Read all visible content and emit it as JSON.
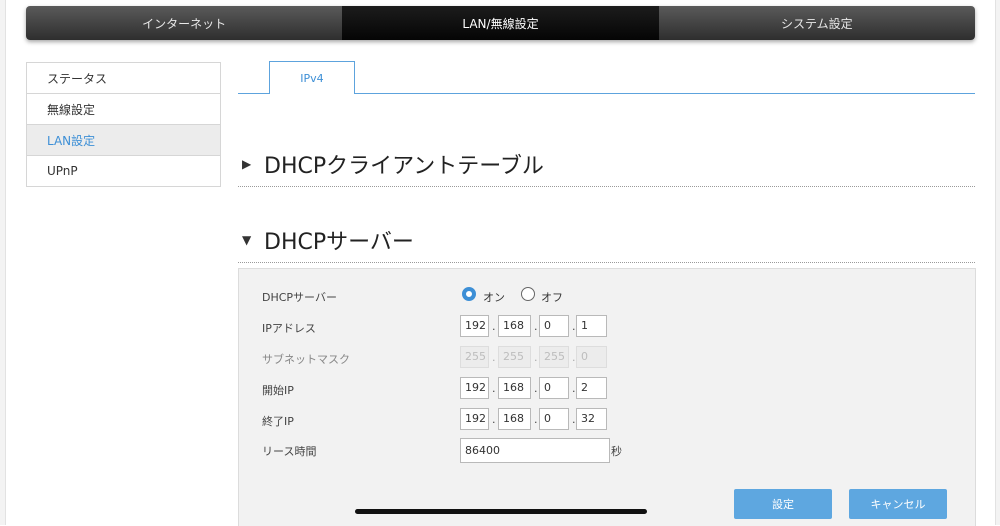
{
  "nav": {
    "tabs": [
      {
        "label": "インターネット"
      },
      {
        "label": "LAN/無線設定"
      },
      {
        "label": "システム設定"
      }
    ],
    "active": "LAN/無線設定"
  },
  "sidebar": {
    "items": [
      {
        "label": "ステータス"
      },
      {
        "label": "無線設定"
      },
      {
        "label": "LAN設定"
      },
      {
        "label": "UPnP"
      }
    ],
    "active": "LAN設定"
  },
  "subtabs": [
    {
      "label": "IPv4"
    }
  ],
  "sections": {
    "client_table": {
      "title": "DHCPクライアントテーブル",
      "icon": "triangle-right-icon"
    },
    "server": {
      "title": "DHCPサーバー",
      "icon": "triangle-down-icon"
    }
  },
  "form": {
    "dhcp_server": {
      "label": "DHCPサーバー",
      "on_label": "オン",
      "off_label": "オフ",
      "selected": "オン"
    },
    "ip_address": {
      "label": "IPアドレス",
      "octets": [
        "192",
        "168",
        "0",
        "1"
      ]
    },
    "subnet_mask": {
      "label": "サブネットマスク",
      "octets": [
        "255",
        "255",
        "255",
        "0"
      ]
    },
    "start_ip": {
      "label": "開始IP",
      "octets": [
        "192",
        "168",
        "0",
        "2"
      ]
    },
    "end_ip": {
      "label": "終了IP",
      "octets": [
        "192",
        "168",
        "0",
        "32"
      ]
    },
    "lease_time": {
      "label": "リース時間",
      "value": "86400",
      "unit": "秒"
    },
    "separator": "."
  },
  "buttons": {
    "apply": "設定",
    "cancel": "キャンセル"
  },
  "colors": {
    "accent": "#3d8fd6",
    "button": "#5ea7e0",
    "nav_dark": "#0a0a0a"
  }
}
